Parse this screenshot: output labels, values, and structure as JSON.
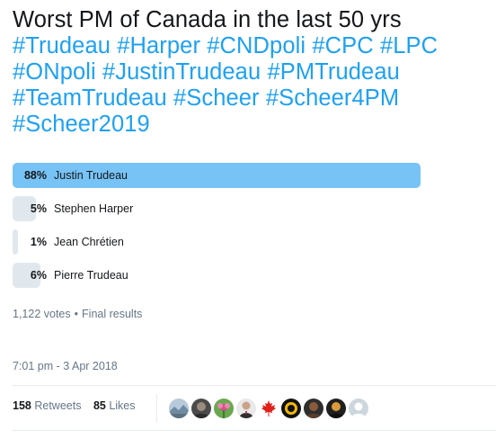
{
  "tweet": {
    "text_plain": "Worst PM of Canada in the last 50 yrs",
    "hashtags": [
      "#Trudeau",
      "#Harper",
      "#CNDpoli",
      "#CPC",
      "#LPC",
      "#ONpoli",
      "#JustinTrudeau",
      "#PMTrudeau",
      "#TeamTrudeau",
      "#Scheer",
      "#Scheer4PM",
      "#Scheer2019"
    ]
  },
  "poll": {
    "options": [
      {
        "percent_label": "88%",
        "label": "Justin Trudeau",
        "percent": 88,
        "winner": true
      },
      {
        "percent_label": "5%",
        "label": "Stephen Harper",
        "percent": 5,
        "winner": false
      },
      {
        "percent_label": "1%",
        "label": "Jean Chrétien",
        "percent": 1,
        "winner": false
      },
      {
        "percent_label": "6%",
        "label": "Pierre Trudeau",
        "percent": 6,
        "winner": false
      }
    ],
    "votes_text": "1,122 votes",
    "separator": "•",
    "status_text": "Final results"
  },
  "timestamp": "7:01 pm - 3 Apr 2018",
  "stats": {
    "retweets_count": "158",
    "retweets_label": "Retweets",
    "likes_count": "85",
    "likes_label": "Likes"
  },
  "likers": [
    {
      "icon": "avatar-landscape-icon",
      "color": "#8aa6c1"
    },
    {
      "icon": "avatar-person-icon",
      "color": "#4a4a4a"
    },
    {
      "icon": "avatar-flower-icon",
      "color": "#6aa84f"
    },
    {
      "icon": "avatar-suit-icon",
      "color": "#3b3b3b"
    },
    {
      "icon": "maple-leaf-icon",
      "color": "#e0201b"
    },
    {
      "icon": "avatar-badge-icon",
      "color": "#111111"
    },
    {
      "icon": "avatar-dark-icon",
      "color": "#5a3e2b"
    },
    {
      "icon": "avatar-bust-icon",
      "color": "#2b2b2b"
    },
    {
      "icon": "default-avatar-icon",
      "color": "#ccd6dd"
    }
  ],
  "colors": {
    "hashtag": "#1da1f2",
    "winner_bar": "#78c3f5",
    "bar": "#e1e8ed",
    "secondary_text": "#657786"
  }
}
